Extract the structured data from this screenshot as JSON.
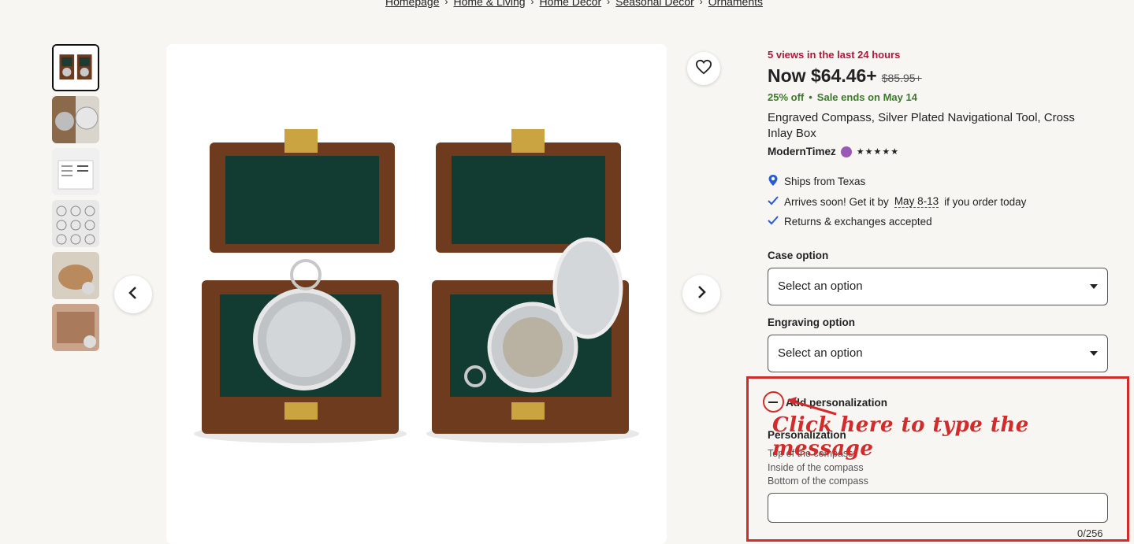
{
  "breadcrumb": [
    "Homepage",
    "Home & Living",
    "Home Decor",
    "Seasonal Decor",
    "Ornaments"
  ],
  "product": {
    "views": "5 views in the last 24 hours",
    "price": "Now $64.46+",
    "old_price": "$85.95+",
    "discount": "25% off",
    "sale_ends": "Sale ends on May 14",
    "title": "Engraved Compass, Silver Plated Navigational Tool, Cross Inlay Box",
    "shop_name": "ModernTimez",
    "stars": "★★★★★"
  },
  "shipping": {
    "ships_from": "Ships from Texas",
    "arrives_prefix": "Arrives soon! Get it by",
    "arrives_dates": "May 8-13",
    "arrives_suffix": "if you order today",
    "returns": "Returns & exchanges accepted"
  },
  "options": {
    "case_label": "Case option",
    "case_value": "Select an option",
    "engraving_label": "Engraving option",
    "engraving_value": "Select an option"
  },
  "personalization": {
    "toggle_label": "Add personalization",
    "label": "Personalization",
    "hint_line1": "Top of the compass:",
    "hint_line2": "Inside of the compass",
    "hint_line3": "Bottom of the compass",
    "counter": "0/256"
  },
  "annotation": {
    "text": "Click here to type the message",
    "color": "#d32a2a"
  },
  "colors": {
    "views_red": "#b0183b",
    "sale_green": "#3c7a2a",
    "page_bg": "#f7f6f3"
  },
  "icons": {
    "prev": "chevron-left-icon",
    "next": "chevron-right-icon",
    "favorite": "heart-icon",
    "location": "location-pin-icon",
    "check": "check-icon",
    "seller_badge": "star-seller-badge-icon"
  }
}
